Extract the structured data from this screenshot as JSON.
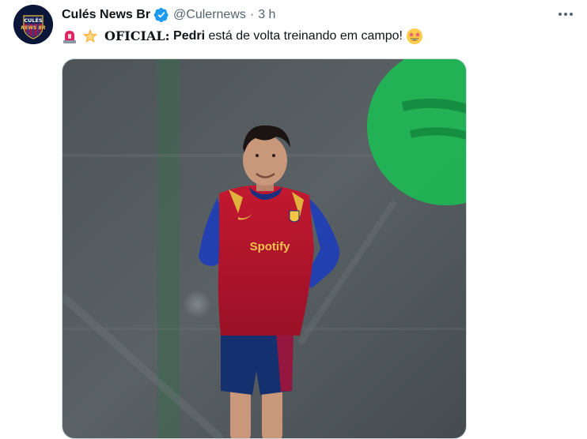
{
  "tweet": {
    "author_name": "Culés News Br",
    "author_handle": "@Culernews",
    "separator": "·",
    "time": "3 h",
    "avatar_text_line1": "CULÉS",
    "avatar_text_line2": "NEWS BR",
    "text_prefix_emojis": [
      "rotating-light-icon",
      "glowing-star-icon"
    ],
    "text_oficial": "OFICIAL:",
    "text_pedri": "Pedri",
    "text_rest": "está de volta treinando em campo!",
    "text_suffix_emoji": "star-struck-icon",
    "media": {
      "alt": "Pedri training on the pitch",
      "shirt_sponsor": "Spotify"
    }
  },
  "colors": {
    "verified_blue": "#1d9bf0",
    "secondary_text": "#536471",
    "spotify_green": "#1db954",
    "barca_blue": "#1f3fa8",
    "barca_red": "#b3102e"
  }
}
